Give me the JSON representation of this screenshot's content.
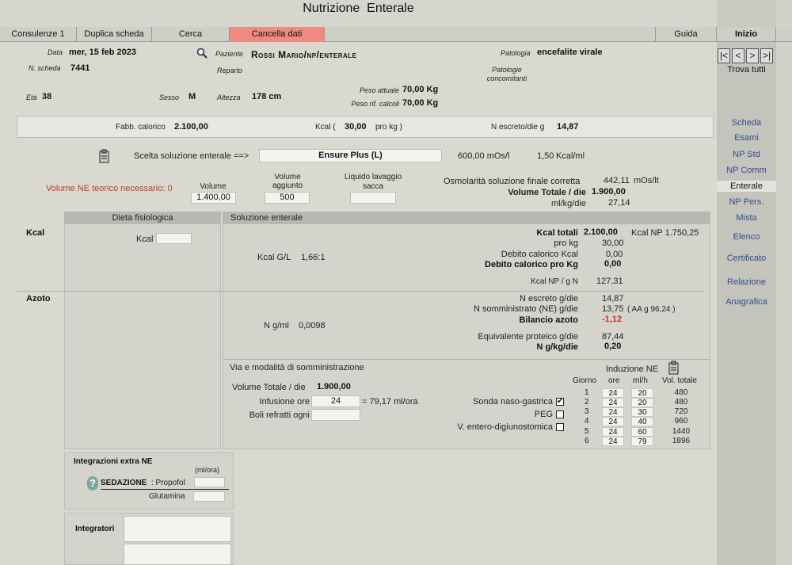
{
  "window": {
    "title": "Nutrizione  Enterale"
  },
  "tabs": {
    "consulenze": "Consulenze 1",
    "duplica": "Duplica scheda",
    "cerca": "Cerca",
    "cancella": "Cancella dati",
    "guida": "Guida",
    "inizio": "Inizio"
  },
  "header": {
    "data_label": "Data",
    "data": "mer, 15 feb 2023",
    "scheda_label": "N. scheda",
    "scheda": "7441",
    "paziente_label": "Paziente",
    "paziente": "Rossi Mario/np/enterale",
    "reparto_label": "Reparto",
    "patologia_label": "Patologia",
    "patologia": "encefalite virale",
    "concomitanti_label": "Patologie concomitanti",
    "peso_att_label": "Peso attuale",
    "peso_att": "70,00 Kg",
    "peso_rif_label": "Peso rif. calcoli",
    "peso_rif": "70,00 Kg",
    "eta_label": "Età",
    "eta": "38",
    "sesso_label": "Sesso",
    "sesso": "M",
    "altezza_label": "Altezza",
    "altezza": "178 cm"
  },
  "caloric": {
    "fabb_label": "Fabb. calorico",
    "fabb": "2.100,00",
    "kcal_label": "Kcal (",
    "kcal": "30,00",
    "kcal_unit": "pro kg )",
    "n_label": "N escreto/die g",
    "n": "14,87"
  },
  "solution": {
    "label": "Scelta soluzione enterale ==>",
    "name": "Ensure Plus (L)",
    "mos": "600,00 mOs/l",
    "kcal": "1,50",
    "kcal_unit": "Kcal/ml"
  },
  "volumes": {
    "teorico": "Volume NE teorico necessario: 0",
    "volume_label": "Volume",
    "volume": "1.400,00",
    "aggiunto_label": "Volume aggiunto",
    "aggiunto": "500",
    "liquido_label": "Liquido lavaggio sacca",
    "liquido": "",
    "osm_label": "Osmolarità soluzione finale corretta",
    "osm": "442,11",
    "osm_unit": "mOs/lt",
    "vt_label": "Volume Totale / die",
    "vt": "1.900,00",
    "mlkg_label": "ml/kg/die",
    "mlkg": "27,14"
  },
  "dieta": {
    "title": "Dieta fisiologica",
    "kcal_label": "Kcal",
    "kcal": ""
  },
  "soluzione": {
    "title": "Soluzione enterale"
  },
  "rows": {
    "kcal": "Kcal",
    "azoto": "Azoto"
  },
  "kcal_section": {
    "gl_label": "Kcal G/L",
    "gl": "1,66:1",
    "tot_label": "Kcal totali",
    "tot": "2.100,00",
    "np_total": "Kcal NP 1.750,25",
    "prokg_label": "pro kg",
    "prokg": "30,00",
    "debito_label": "Debito calorico Kcal",
    "debito": "0,00",
    "debitokg_label": "Debito calorico pro Kg",
    "debitokg": "0,00",
    "npg_label": "Kcal NP / g N",
    "npg": "127,31"
  },
  "azoto_section": {
    "ngml_label": "N g/ml",
    "ngml": "0,0098",
    "escreto_label": "N  escreto g/die",
    "escreto": "14,87",
    "somm_label": "N somministrato (NE) g/die",
    "somm": "13,75",
    "aa": "( AA g 96,24 )",
    "bilancio_label": "Bilancio azoto",
    "bilancio": "-1,12",
    "equiv_label": "Equivalente proteico g/die",
    "equiv": "87,44",
    "ngkg_label": "N g/kg/die",
    "ngkg": "0,20"
  },
  "via": {
    "title": "Via e modalità di somministrazione",
    "vt_label": "Volume Totale / die",
    "vt": "1.900,00",
    "inf_label": "Infusione ore",
    "inf": "24",
    "inf_rate": "= 79,17 ml/ora",
    "boli_label": "Boli refratti ogni",
    "boli": "",
    "sonda_label": "Sonda naso-gastrica",
    "peg_label": "PEG",
    "vent_label": "V. entero-digiunostomica",
    "check_mark": "✔"
  },
  "induzione": {
    "title": "Induzione NE",
    "h_giorno": "Giorno",
    "h_ore": "ore",
    "h_mlh": "ml/h",
    "h_vol": "Vol. totale",
    "rows": [
      [
        "1",
        "24",
        "20",
        "480"
      ],
      [
        "2",
        "24",
        "20",
        "480"
      ],
      [
        "3",
        "24",
        "30",
        "720"
      ],
      [
        "4",
        "24",
        "40",
        "960"
      ],
      [
        "5",
        "24",
        "60",
        "1440"
      ],
      [
        "6",
        "24",
        "79",
        "1896"
      ]
    ]
  },
  "integrazioni": {
    "title": "Integrazioni extra NE",
    "unit": "(ml/ora)",
    "help": "?",
    "sedazione": "SEDAZIONE",
    "propofol": ": Propofol",
    "glutamina": "Glutamina"
  },
  "integratori": {
    "title": "Integratori"
  },
  "nav": {
    "first": "|<",
    "prev": "<",
    "next": ">",
    "last": ">|",
    "trova": "Trova tutti",
    "items": [
      "Scheda",
      "Esami",
      "NP Std",
      "NP Comm",
      "Enterale",
      "NP Pers.",
      "Mista",
      "Elenco",
      "Certificato",
      "Relazione",
      "Anagrafica"
    ]
  },
  "colors": {
    "accent": "#f08a80",
    "link": "#2f4e8c",
    "alert": "#c0392b"
  }
}
